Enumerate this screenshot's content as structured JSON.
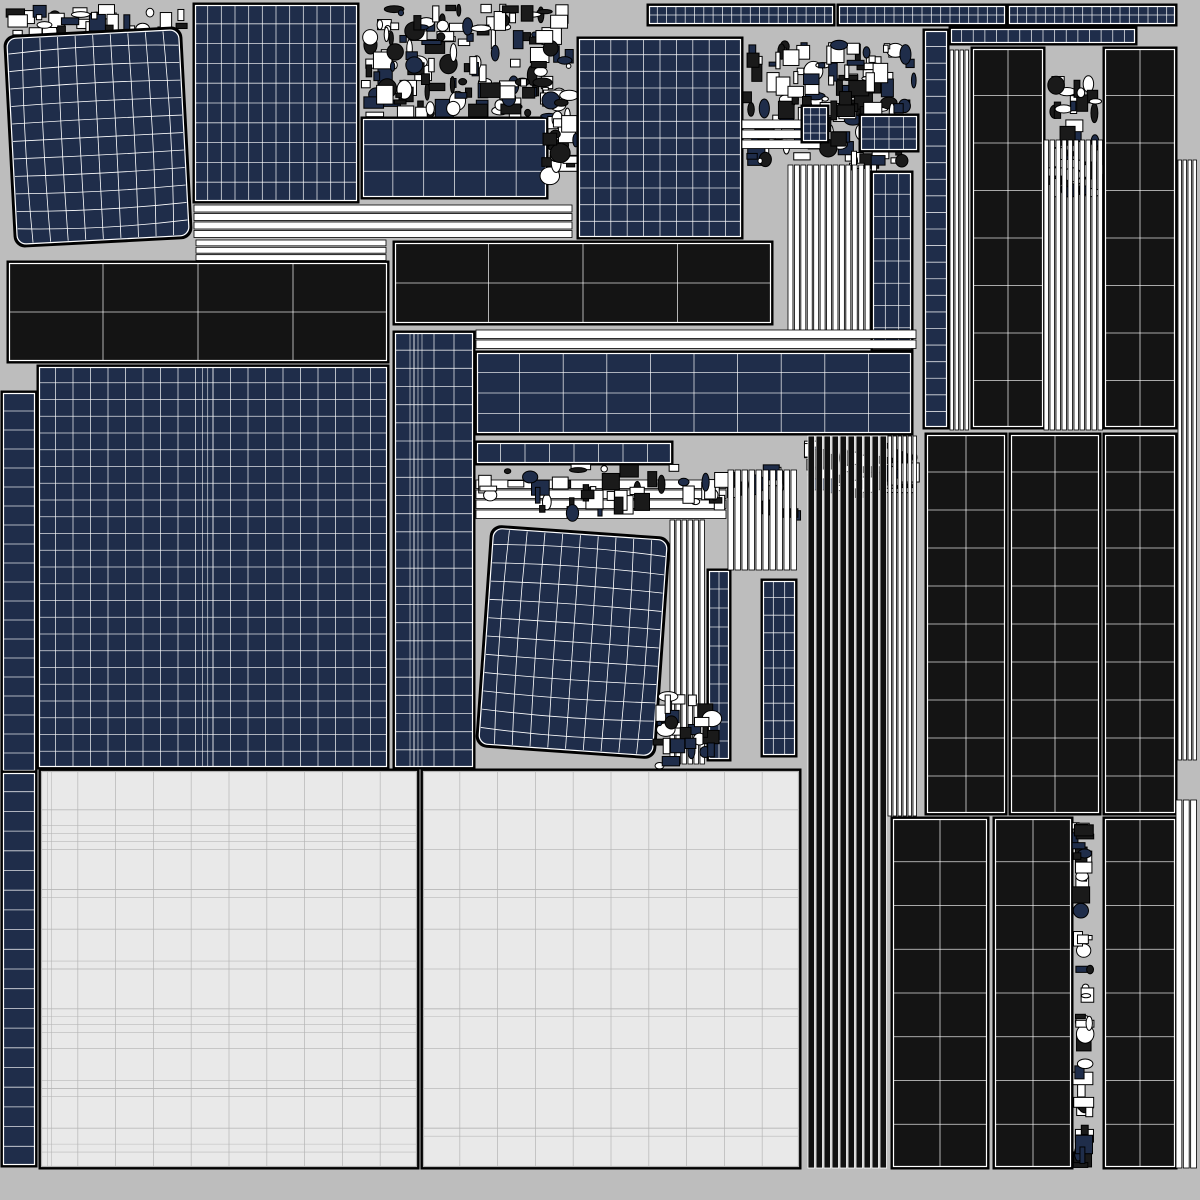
{
  "canvas": {
    "background": "#bdbdbd"
  },
  "palette": {
    "navy_fill": "#1f2d4a",
    "dark_fill": "#141414",
    "light_fill": "#e9e9e9",
    "wire_on_dark": "#ffffff",
    "wire_on_light": "#b4b4b4",
    "island_outline": "#000000"
  },
  "island_kinds": [
    "navy-uv-island",
    "dark-uv-island",
    "light-uv-island",
    "clutter-uv-region",
    "strip-uv-island"
  ]
}
